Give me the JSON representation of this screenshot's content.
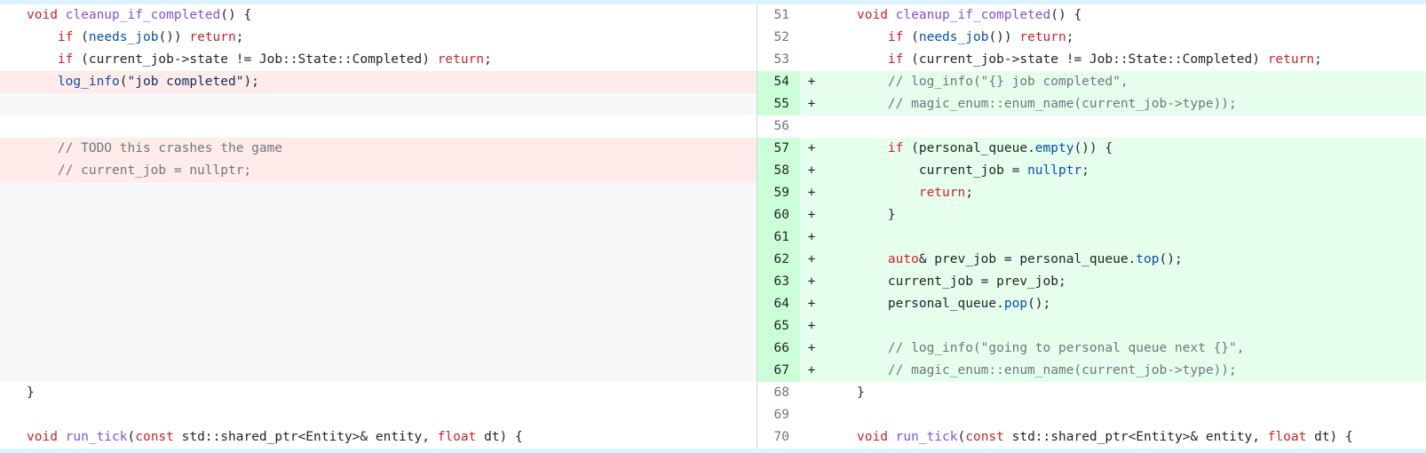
{
  "left_pane": {
    "lines": [
      {
        "type": "context",
        "tokens": [
          {
            "t": "void",
            "c": "kw"
          },
          {
            "t": " "
          },
          {
            "t": "cleanup_if_completed",
            "c": "fn"
          },
          {
            "t": "() {"
          }
        ]
      },
      {
        "type": "context",
        "tokens": [
          {
            "t": "    "
          },
          {
            "t": "if",
            "c": "kw"
          },
          {
            "t": " ("
          },
          {
            "t": "needs_job",
            "c": "call"
          },
          {
            "t": "()) "
          },
          {
            "t": "return",
            "c": "kw"
          },
          {
            "t": ";"
          }
        ]
      },
      {
        "type": "context",
        "tokens": [
          {
            "t": "    "
          },
          {
            "t": "if",
            "c": "kw"
          },
          {
            "t": " (current_job->state != Job::State::Completed) "
          },
          {
            "t": "return",
            "c": "kw"
          },
          {
            "t": ";"
          }
        ]
      },
      {
        "type": "del",
        "tokens": [
          {
            "t": "    "
          },
          {
            "t": "log_info",
            "c": "call"
          },
          {
            "t": "("
          },
          {
            "t": "\"job completed\"",
            "c": "str"
          },
          {
            "t": ");"
          }
        ]
      },
      {
        "type": "filler",
        "tokens": []
      },
      {
        "type": "context",
        "tokens": []
      },
      {
        "type": "del",
        "tokens": [
          {
            "t": "    "
          },
          {
            "t": "// TODO this crashes the game",
            "c": "cm"
          }
        ]
      },
      {
        "type": "del",
        "tokens": [
          {
            "t": "    "
          },
          {
            "t": "// current_job = nullptr;",
            "c": "cm"
          }
        ]
      },
      {
        "type": "filler",
        "tokens": []
      },
      {
        "type": "filler",
        "tokens": []
      },
      {
        "type": "filler",
        "tokens": []
      },
      {
        "type": "filler",
        "tokens": []
      },
      {
        "type": "filler",
        "tokens": []
      },
      {
        "type": "filler",
        "tokens": []
      },
      {
        "type": "filler",
        "tokens": []
      },
      {
        "type": "filler",
        "tokens": []
      },
      {
        "type": "filler",
        "tokens": []
      },
      {
        "type": "context",
        "tokens": [
          {
            "t": "}"
          }
        ]
      },
      {
        "type": "context",
        "tokens": []
      },
      {
        "type": "context",
        "tokens": [
          {
            "t": "void",
            "c": "kw"
          },
          {
            "t": " "
          },
          {
            "t": "run_tick",
            "c": "fn"
          },
          {
            "t": "("
          },
          {
            "t": "const",
            "c": "kw"
          },
          {
            "t": " std::shared_ptr<Entity>& entity, "
          },
          {
            "t": "float",
            "c": "kw"
          },
          {
            "t": " dt) {"
          }
        ]
      }
    ]
  },
  "right_pane": {
    "lines": [
      {
        "num": "51",
        "type": "context",
        "marker": "",
        "tokens": [
          {
            "t": "void",
            "c": "kw"
          },
          {
            "t": " "
          },
          {
            "t": "cleanup_if_completed",
            "c": "fn"
          },
          {
            "t": "() {"
          }
        ]
      },
      {
        "num": "52",
        "type": "context",
        "marker": "",
        "tokens": [
          {
            "t": "    "
          },
          {
            "t": "if",
            "c": "kw"
          },
          {
            "t": " ("
          },
          {
            "t": "needs_job",
            "c": "call"
          },
          {
            "t": "()) "
          },
          {
            "t": "return",
            "c": "kw"
          },
          {
            "t": ";"
          }
        ]
      },
      {
        "num": "53",
        "type": "context",
        "marker": "",
        "tokens": [
          {
            "t": "    "
          },
          {
            "t": "if",
            "c": "kw"
          },
          {
            "t": " (current_job->state != Job::State::Completed) "
          },
          {
            "t": "return",
            "c": "kw"
          },
          {
            "t": ";"
          }
        ]
      },
      {
        "num": "54",
        "type": "add",
        "marker": "+",
        "tokens": [
          {
            "t": "    "
          },
          {
            "t": "// log_info(\"{} job completed\",",
            "c": "cm"
          }
        ]
      },
      {
        "num": "55",
        "type": "add",
        "marker": "+",
        "tokens": [
          {
            "t": "    "
          },
          {
            "t": "// magic_enum::enum_name(current_job->type));",
            "c": "cm"
          }
        ]
      },
      {
        "num": "56",
        "type": "context",
        "marker": "",
        "tokens": []
      },
      {
        "num": "57",
        "type": "add",
        "marker": "+",
        "tokens": [
          {
            "t": "    "
          },
          {
            "t": "if",
            "c": "kw"
          },
          {
            "t": " (personal_queue."
          },
          {
            "t": "empty",
            "c": "call"
          },
          {
            "t": "()) {"
          }
        ]
      },
      {
        "num": "58",
        "type": "add",
        "marker": "+",
        "tokens": [
          {
            "t": "        current_job = "
          },
          {
            "t": "nullptr",
            "c": "call"
          },
          {
            "t": ";"
          }
        ]
      },
      {
        "num": "59",
        "type": "add",
        "marker": "+",
        "tokens": [
          {
            "t": "        "
          },
          {
            "t": "return",
            "c": "kw"
          },
          {
            "t": ";"
          }
        ]
      },
      {
        "num": "60",
        "type": "add",
        "marker": "+",
        "tokens": [
          {
            "t": "    }"
          }
        ]
      },
      {
        "num": "61",
        "type": "add",
        "marker": "+",
        "tokens": []
      },
      {
        "num": "62",
        "type": "add",
        "marker": "+",
        "tokens": [
          {
            "t": "    "
          },
          {
            "t": "auto",
            "c": "kw"
          },
          {
            "t": "& prev_job = personal_queue."
          },
          {
            "t": "top",
            "c": "call"
          },
          {
            "t": "();"
          }
        ]
      },
      {
        "num": "63",
        "type": "add",
        "marker": "+",
        "tokens": [
          {
            "t": "    current_job = prev_job;"
          }
        ]
      },
      {
        "num": "64",
        "type": "add",
        "marker": "+",
        "tokens": [
          {
            "t": "    personal_queue."
          },
          {
            "t": "pop",
            "c": "call"
          },
          {
            "t": "();"
          }
        ]
      },
      {
        "num": "65",
        "type": "add",
        "marker": "+",
        "tokens": []
      },
      {
        "num": "66",
        "type": "add",
        "marker": "+",
        "tokens": [
          {
            "t": "    "
          },
          {
            "t": "// log_info(\"going to personal queue next {}\",",
            "c": "cm"
          }
        ]
      },
      {
        "num": "67",
        "type": "add",
        "marker": "+",
        "tokens": [
          {
            "t": "    "
          },
          {
            "t": "// magic_enum::enum_name(current_job->type));",
            "c": "cm"
          }
        ]
      },
      {
        "num": "68",
        "type": "context",
        "marker": "",
        "tokens": [
          {
            "t": "}"
          }
        ]
      },
      {
        "num": "69",
        "type": "context",
        "marker": "",
        "tokens": []
      },
      {
        "num": "70",
        "type": "context",
        "marker": "",
        "tokens": [
          {
            "t": "void",
            "c": "kw"
          },
          {
            "t": " "
          },
          {
            "t": "run_tick",
            "c": "fn"
          },
          {
            "t": "("
          },
          {
            "t": "const",
            "c": "kw"
          },
          {
            "t": " std::shared_ptr<Entity>& entity, "
          },
          {
            "t": "float",
            "c": "kw"
          },
          {
            "t": " dt) {"
          }
        ]
      }
    ]
  },
  "colors": {
    "deletion_bg": "#ffebe9",
    "addition_bg": "#e6ffec",
    "addition_gutter_bg": "#ccffd8",
    "filler_bg": "#f6f8fa",
    "keyword": "#cf222e",
    "function_def": "#8250df",
    "call": "#0550ae",
    "string": "#0a3069",
    "comment": "#6e7781"
  }
}
